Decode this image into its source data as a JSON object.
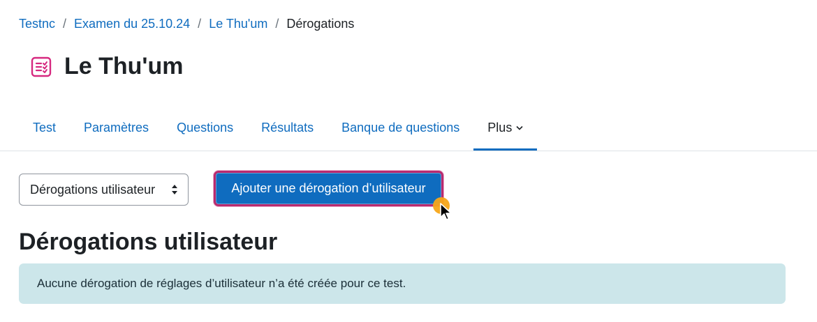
{
  "breadcrumb": {
    "items": [
      "Testnc",
      "Examen du 25.10.24",
      "Le Thu'um"
    ],
    "separator": "/",
    "current": "Dérogations"
  },
  "page": {
    "icon": "quiz-icon",
    "title": "Le Thu'um"
  },
  "tabs": [
    {
      "label": "Test"
    },
    {
      "label": "Paramètres"
    },
    {
      "label": "Questions"
    },
    {
      "label": "Résultats"
    },
    {
      "label": "Banque de questions"
    },
    {
      "label": "Plus",
      "active": true
    }
  ],
  "override_select": {
    "selected": "Dérogations utilisateur"
  },
  "add_button": {
    "label": "Ajouter une dérogation d’utilisateur"
  },
  "section": {
    "heading": "Dérogations utilisateur"
  },
  "alert": {
    "message": "Aucune dérogation de réglages d’utilisateur n’a été créée pour ce test."
  },
  "colors": {
    "link": "#0f6cbf",
    "primary_button": "#0f6cbf",
    "focus_border": "#b82a6e",
    "icon_magenta": "#d6287f",
    "alert_bg": "#cce6ea",
    "cursor_highlight": "#f7a619"
  }
}
